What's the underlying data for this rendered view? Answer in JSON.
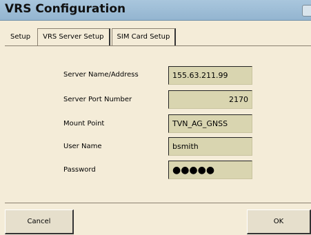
{
  "window": {
    "title": "VRS Configuration"
  },
  "tabs": [
    {
      "label": "Setup"
    },
    {
      "label": "VRS Server Setup"
    },
    {
      "label": "SIM Card Setup"
    }
  ],
  "form": {
    "server_name": {
      "label": "Server Name/Address",
      "value": "155.63.211.99"
    },
    "server_port": {
      "label": "Server Port Number",
      "value": "2170"
    },
    "mount_point": {
      "label": "Mount Point",
      "value": "TVN_AG_GNSS"
    },
    "user_name": {
      "label": "User Name",
      "value": "bsmith"
    },
    "password": {
      "label": "Password",
      "value": "●●●●●"
    }
  },
  "buttons": {
    "cancel": "Cancel",
    "ok": "OK"
  }
}
